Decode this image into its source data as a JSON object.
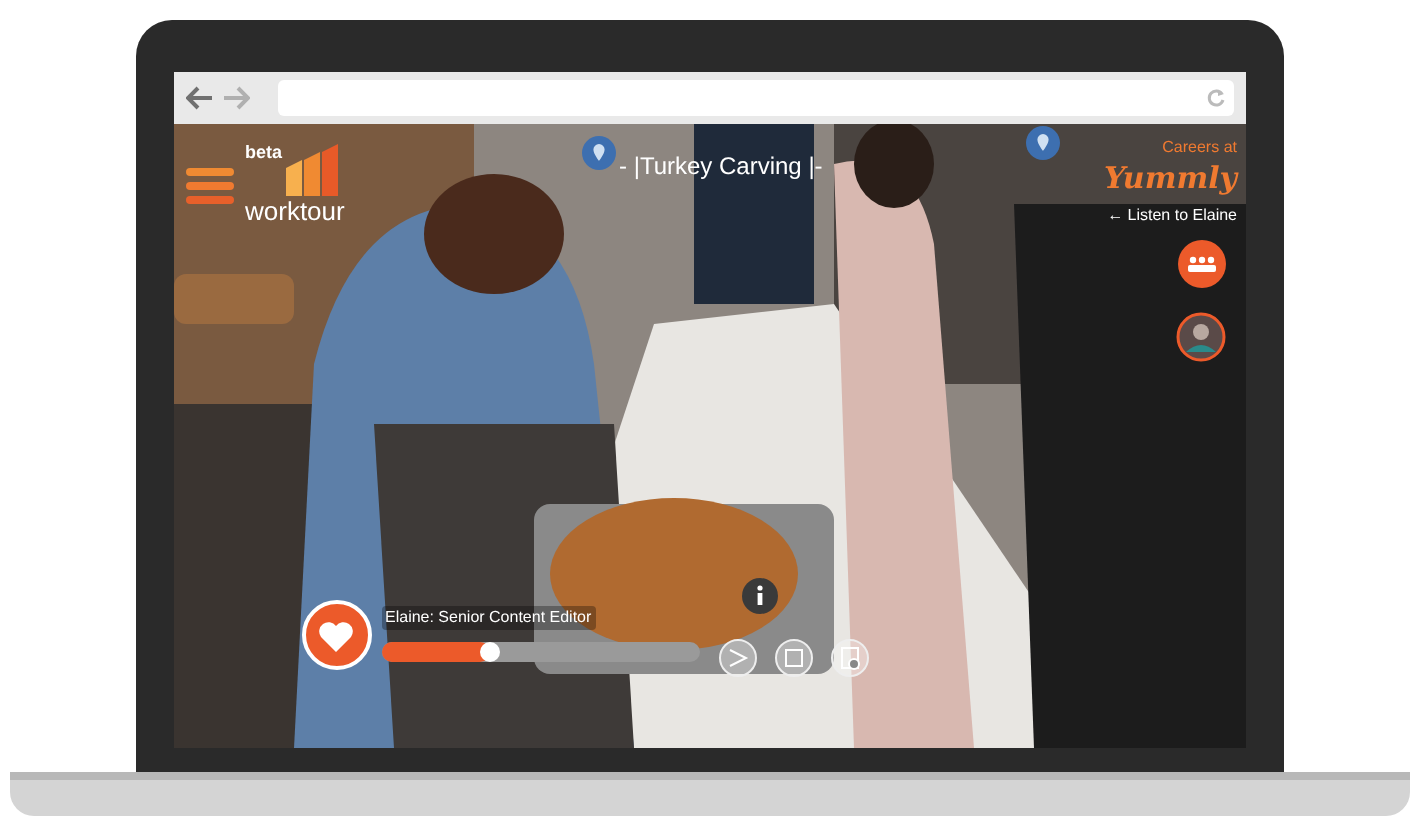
{
  "browser": {
    "back_enabled": true,
    "forward_enabled": false
  },
  "tour": {
    "logo_badge": "beta",
    "logo_text": "worktour",
    "title": "- |Turkey Carving |-",
    "careers_label": "Careers at",
    "company": "Yummly",
    "listen_hint": "← Listen to Elaine",
    "speaker": "Elaine: Senior Content Editor",
    "progress": {
      "level": 0.34
    }
  }
}
